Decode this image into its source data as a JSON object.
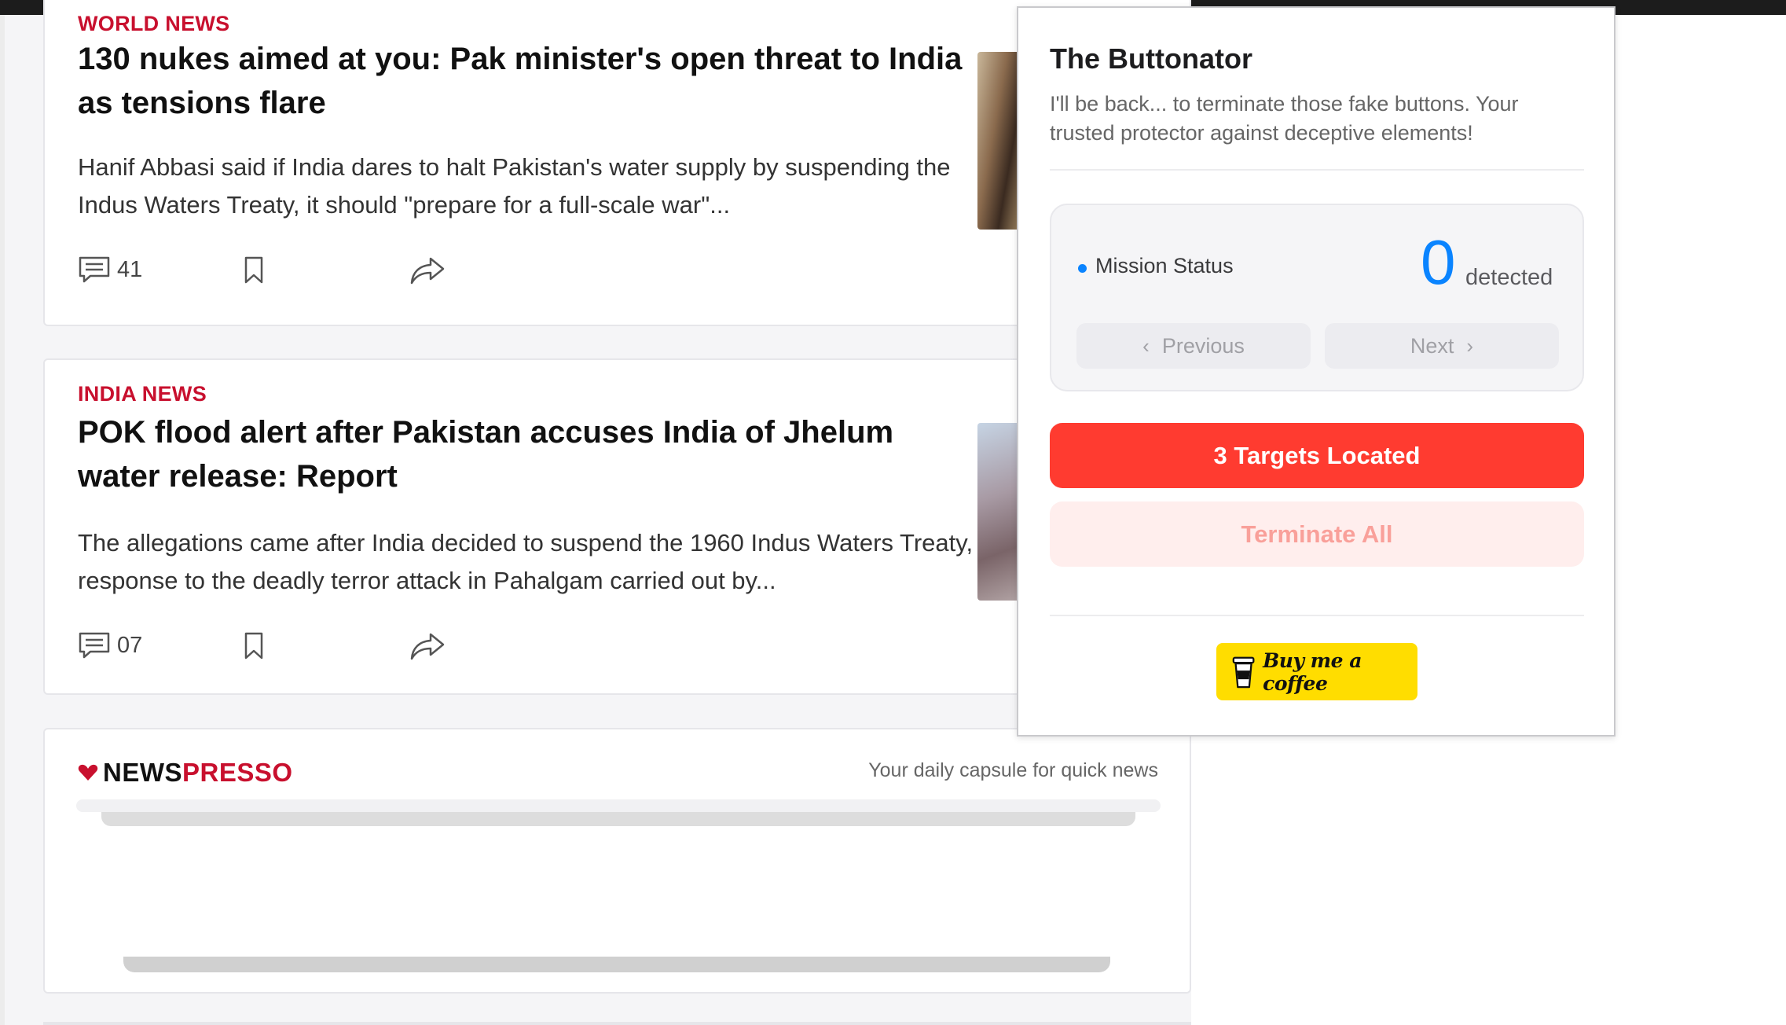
{
  "articles": [
    {
      "category": "WORLD NEWS",
      "headline": "130 nukes aimed at you: Pak minister's open threat to India as tensions flare",
      "summary": "Hanif Abbasi said if India dares to halt Pakistan's water supply by suspending the Indus Waters Treaty, it should \"prepare for a full-scale war\"...",
      "comments": "41"
    },
    {
      "category": "INDIA NEWS",
      "headline": "POK flood alert after Pakistan accuses India of Jhelum water release: Report",
      "summary": "The allegations came after India decided to suspend the 1960 Indus Waters Treaty, in response to the deadly terror attack in Pahalgam carried out by...",
      "comments": "07"
    }
  ],
  "newspresso": {
    "brand_news": "NEWS",
    "brand_presso": "PRESSO",
    "tagline": "Your daily capsule for quick news"
  },
  "popup": {
    "title": "The Buttonator",
    "description": "I'll be back... to terminate those fake buttons. Your trusted protector against deceptive elements!",
    "status_label": "Mission Status",
    "detected_count": "0",
    "detected_label": "detected",
    "prev_label": "Previous",
    "next_label": "Next",
    "targets_label": "3 Targets Located",
    "terminate_label": "Terminate All",
    "coffee_label": "Buy me a coffee"
  },
  "colors": {
    "category_red": "#c8102e",
    "status_blue": "#0a84ff",
    "targets_red": "#ff3b30",
    "coffee_yellow": "#ffdd00"
  }
}
